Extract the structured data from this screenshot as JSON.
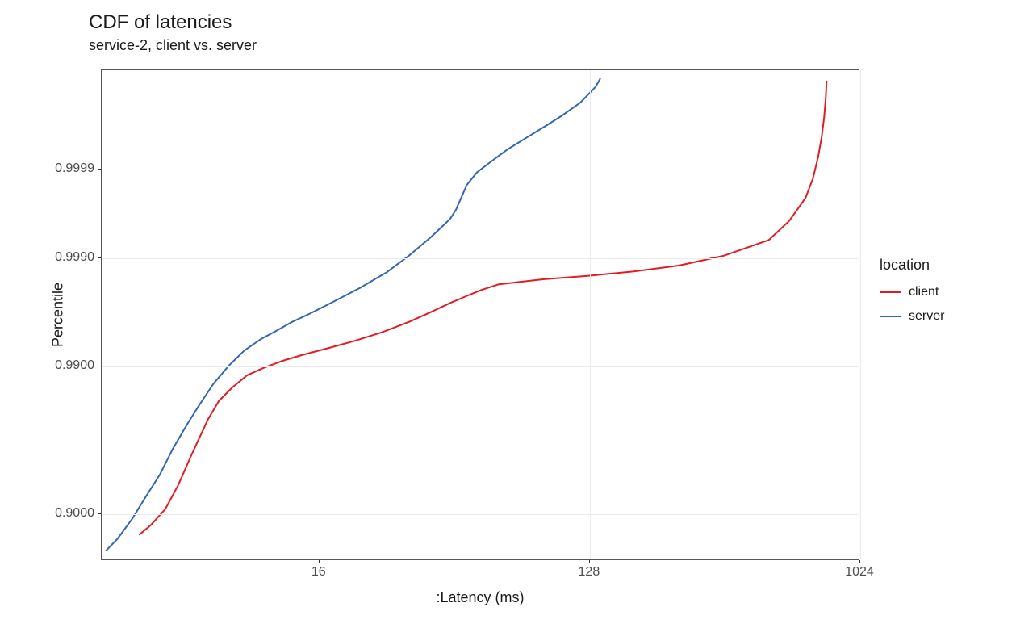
{
  "chart_data": {
    "type": "line",
    "title": "CDF of latencies",
    "subtitle": "service-2, client vs. server",
    "xlabel": ":Latency (ms)",
    "ylabel": "Percentile",
    "x_scale": "log2",
    "y_scale": "probit",
    "x_ticks": [
      16,
      128,
      1024
    ],
    "y_ticks": [
      0.9,
      0.99,
      0.999,
      0.9999
    ],
    "y_tick_labels": [
      "0.9000",
      "0.9900",
      "0.9990",
      "0.9999"
    ],
    "xlim": [
      3.0,
      1024
    ],
    "legend_title": "location",
    "legend_position": "right",
    "series": [
      {
        "name": "client",
        "color": "#E31B23",
        "x": [
          4.0,
          4.4,
          4.9,
          5.4,
          6.0,
          6.8,
          7.4,
          8.2,
          9.2,
          10.4,
          12.0,
          14.0,
          17.0,
          21.0,
          26.0,
          32.0,
          38.0,
          44.0,
          50.0,
          56.0,
          64.0,
          90.0,
          128.0,
          180.0,
          256.0,
          362.0,
          512.0,
          600.0,
          680.0,
          720.0,
          750.0,
          770.0,
          785.0,
          795.0,
          800.0
        ],
        "y": [
          0.87,
          0.885,
          0.905,
          0.93,
          0.955,
          0.974,
          0.981,
          0.985,
          0.988,
          0.9895,
          0.9908,
          0.9918,
          0.9928,
          0.9938,
          0.9948,
          0.9958,
          0.9966,
          0.9972,
          0.9976,
          0.9979,
          0.99815,
          0.99835,
          0.99848,
          0.99862,
          0.9988,
          0.99905,
          0.99935,
          0.9996,
          0.99978,
          0.99987,
          0.99993,
          0.99996,
          0.999978,
          0.999988,
          0.999993
        ]
      },
      {
        "name": "server",
        "color": "#3366B2",
        "x": [
          3.1,
          3.4,
          3.8,
          4.2,
          4.7,
          5.2,
          5.8,
          6.4,
          7.1,
          8.0,
          9.0,
          10.2,
          11.6,
          13.0,
          15.0,
          18.0,
          22.0,
          27.0,
          32.0,
          38.0,
          44.0,
          46.0,
          48.0,
          50.0,
          54.0,
          60.0,
          68.0,
          78.0,
          90.0,
          104.0,
          120.0,
          135.0,
          140.0
        ],
        "y": [
          0.845,
          0.865,
          0.893,
          0.918,
          0.94,
          0.959,
          0.972,
          0.98,
          0.986,
          0.99,
          0.9925,
          0.994,
          0.995,
          0.9958,
          0.9965,
          0.9973,
          0.998,
          0.9986,
          0.99905,
          0.9994,
          0.99962,
          0.9997,
          0.999785,
          0.999845,
          0.99989,
          0.999918,
          0.999942,
          0.999958,
          0.99997,
          0.999979,
          0.999986,
          0.9999915,
          0.9999935
        ]
      }
    ]
  }
}
